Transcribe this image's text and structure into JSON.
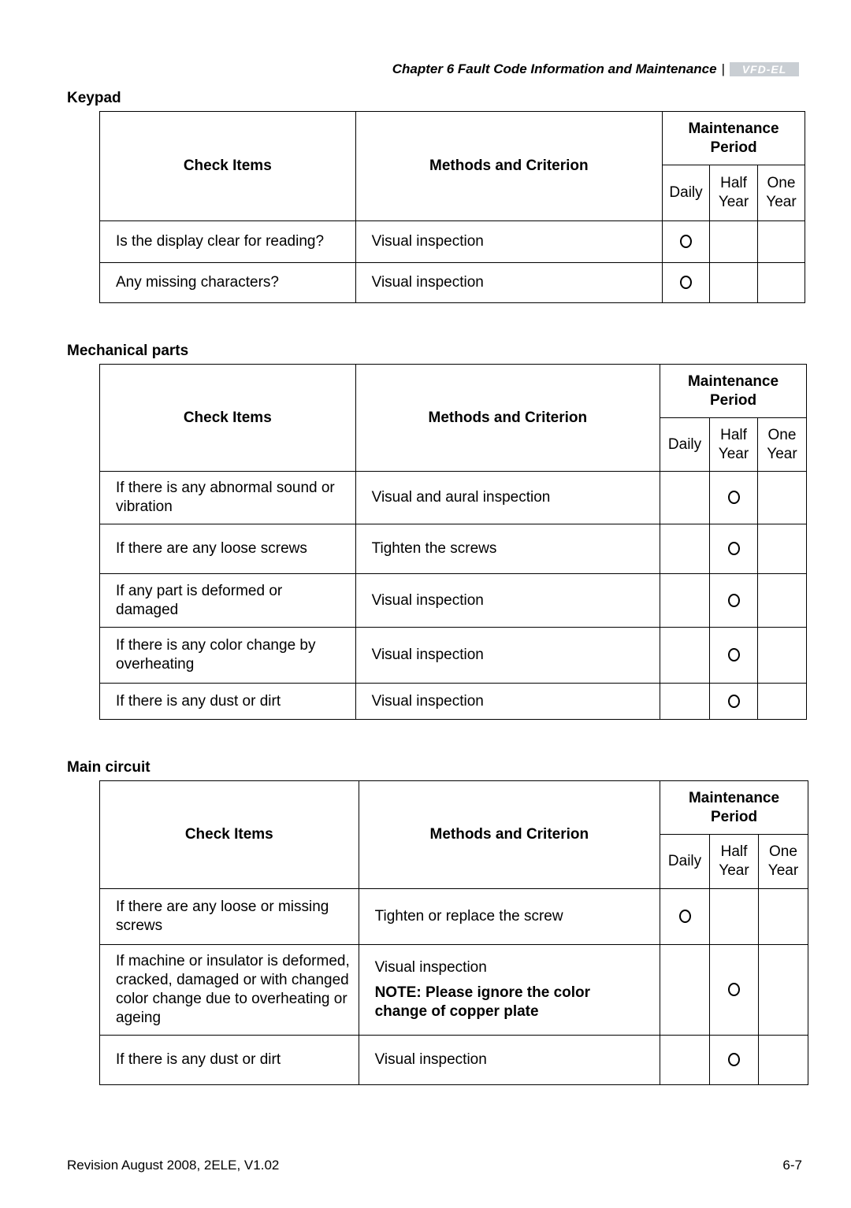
{
  "header": {
    "chapter_title": "Chapter 6 Fault Code Information and Maintenance",
    "separator": "|",
    "logo_text": "VFD-EL"
  },
  "column_headers": {
    "check_items": "Check Items",
    "methods": "Methods and Criterion",
    "maintenance_period": "Maintenance Period",
    "daily": "Daily",
    "half_year": "Half Year",
    "one_year": "One Year"
  },
  "sections": [
    {
      "title": "Keypad",
      "rows": [
        {
          "item": "Is the display clear for reading?",
          "method": "Visual inspection",
          "note": "",
          "period": "daily"
        },
        {
          "item": "Any missing characters?",
          "method": "Visual inspection",
          "note": "",
          "period": "daily"
        }
      ]
    },
    {
      "title": "Mechanical parts",
      "rows": [
        {
          "item": "If there is any abnormal sound or vibration",
          "method": "Visual and aural inspection",
          "note": "",
          "period": "half_year"
        },
        {
          "item": "If there are any loose screws",
          "method": "Tighten the screws",
          "note": "",
          "period": "half_year"
        },
        {
          "item": "If any part is deformed or damaged",
          "method": "Visual inspection",
          "note": "",
          "period": "half_year"
        },
        {
          "item": "If there is any color change by overheating",
          "method": "Visual inspection",
          "note": "",
          "period": "half_year"
        },
        {
          "item": "If there is any dust or dirt",
          "method": "Visual inspection",
          "note": "",
          "period": "half_year"
        }
      ]
    },
    {
      "title": "Main circuit",
      "rows": [
        {
          "item": "If there are any loose or missing screws",
          "method": "Tighten or replace the screw",
          "note": "",
          "period": "daily"
        },
        {
          "item": "If machine or insulator is deformed, cracked, damaged or with changed color change due to overheating or ageing",
          "method": "Visual inspection",
          "note": "NOTE: Please ignore the color change of copper plate",
          "period": "half_year"
        },
        {
          "item": "If there is any dust or dirt",
          "method": "Visual inspection",
          "note": "",
          "period": "half_year"
        }
      ]
    }
  ],
  "footer": {
    "revision": "Revision August 2008, 2ELE, V1.02",
    "page_number": "6-7"
  }
}
